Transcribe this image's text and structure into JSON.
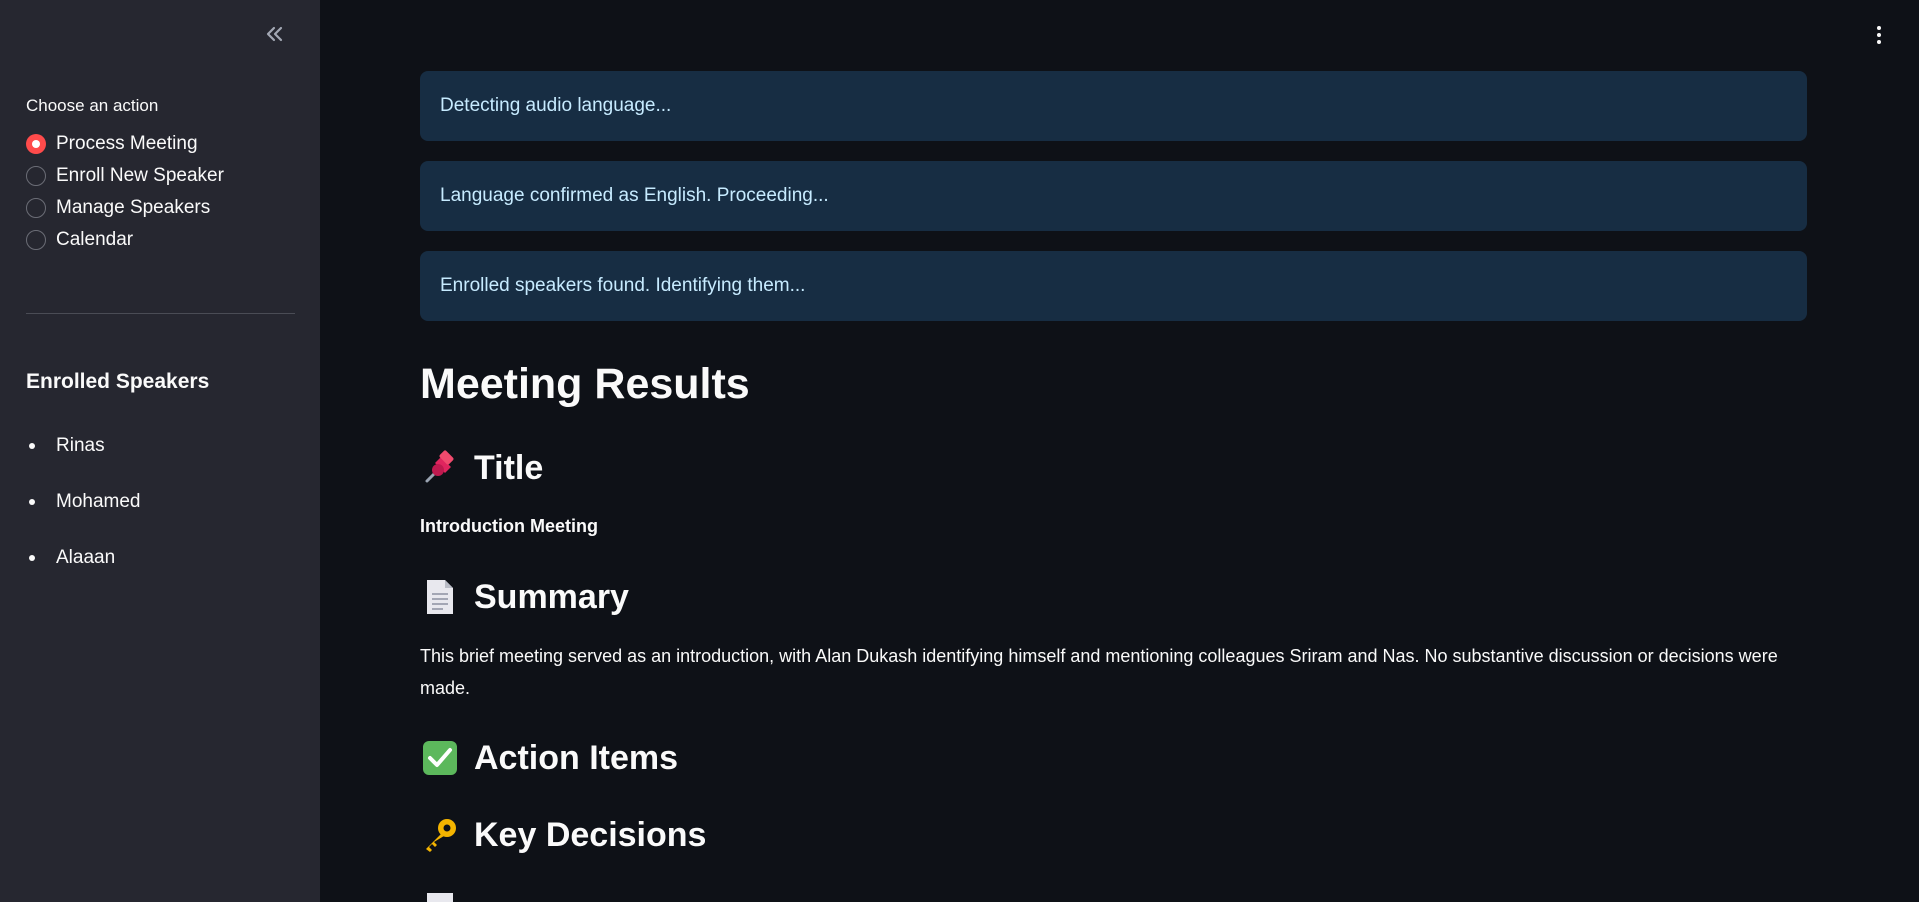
{
  "sidebar": {
    "radio_label": "Choose an action",
    "options": [
      {
        "label": "Process Meeting",
        "checked": true
      },
      {
        "label": "Enroll New Speaker",
        "checked": false
      },
      {
        "label": "Manage Speakers",
        "checked": false
      },
      {
        "label": "Calendar",
        "checked": false
      }
    ],
    "enrolled_heading": "Enrolled Speakers",
    "speakers": [
      "Rinas",
      "Mohamed",
      "Alaaan"
    ]
  },
  "alerts": [
    "Detecting audio language...",
    "Language confirmed as English. Proceeding...",
    "Enrolled speakers found. Identifying them..."
  ],
  "main": {
    "heading": "Meeting Results",
    "title_section": "Title",
    "title_value": "Introduction Meeting",
    "summary_section": "Summary",
    "summary_text": "This brief meeting served as an introduction, with Alan Dukash identifying himself and mentioning colleagues Sriram and Nas. No substantive discussion or decisions were made.",
    "action_items_section": "Action Items",
    "key_decisions_section": "Key Decisions"
  },
  "colors": {
    "accent": "#ff4b4b",
    "background": "#0e1117",
    "sidebar": "#262730",
    "alert_bg": "#172d43",
    "alert_text": "#c7ebff"
  },
  "icons": {
    "collapse": "double-chevron-left-icon",
    "menu": "kebab-menu-icon",
    "title": "pushpin-icon",
    "summary": "document-icon",
    "action_items": "check-mark-button-icon",
    "key_decisions": "key-icon"
  }
}
